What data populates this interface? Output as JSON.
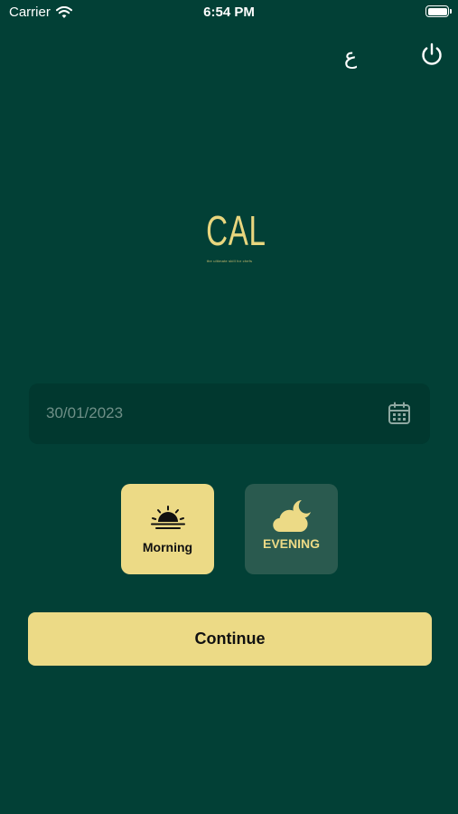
{
  "status_bar": {
    "carrier": "Carrier",
    "time": "6:54 PM"
  },
  "header": {
    "language_toggle_label": "ع",
    "power_icon": "power-icon"
  },
  "logo": {
    "text": "CAL",
    "tagline": "the ultimate skill for chefs"
  },
  "date_field": {
    "value": "30/01/2023",
    "icon": "calendar-icon"
  },
  "shift": {
    "selected": "morning",
    "options": [
      {
        "id": "morning",
        "label": "Morning",
        "icon": "sunrise-icon"
      },
      {
        "id": "evening",
        "label": "EVENING",
        "icon": "cloud-moon-icon"
      }
    ]
  },
  "continue_label": "Continue",
  "colors": {
    "background": "#024036",
    "accent": "#ecda86",
    "field": "#01382f",
    "inactive_option": "#2a5a4f"
  }
}
